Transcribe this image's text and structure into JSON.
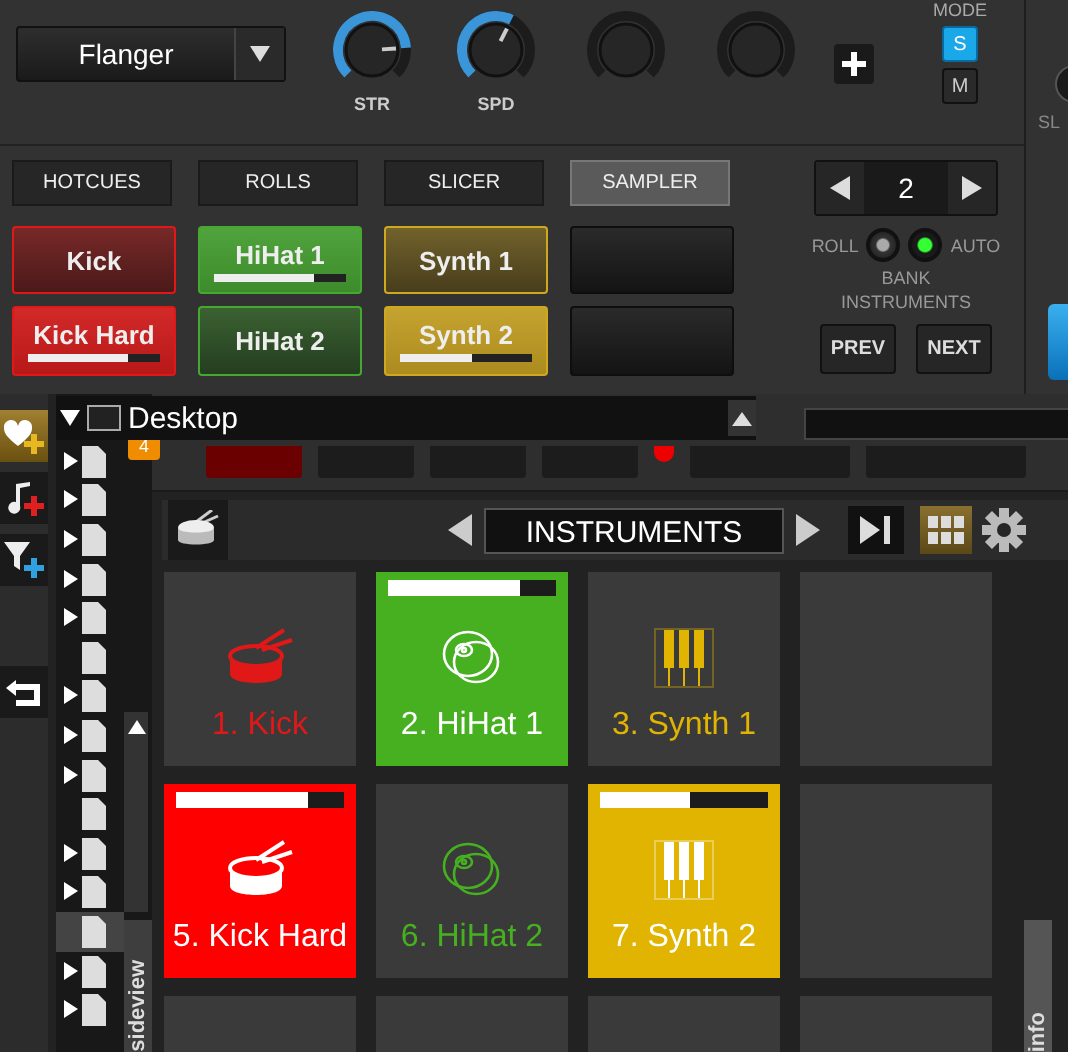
{
  "effect": {
    "value": "Flanger"
  },
  "knobs": [
    {
      "kind": "effect",
      "label": "STR",
      "level": 0.82
    },
    {
      "kind": "effect",
      "label": "SPD",
      "level": 0.6
    },
    {
      "kind": "blank"
    },
    {
      "kind": "blank"
    }
  ],
  "mode": {
    "label": "MODE",
    "options": [
      {
        "label": "S",
        "selected": true
      },
      {
        "label": "M",
        "selected": false
      }
    ]
  },
  "side_label": "SL",
  "tabs": [
    {
      "label": "HOTCUES",
      "selected": false
    },
    {
      "label": "ROLLS",
      "selected": false
    },
    {
      "label": "SLICER",
      "selected": false
    },
    {
      "label": "SAMPLER",
      "selected": true
    }
  ],
  "pads": [
    {
      "kind": "sample",
      "label": "Kick",
      "color": "#e01818",
      "playing": false
    },
    {
      "kind": "sample",
      "label": "HiHat 1",
      "color": "#46a830",
      "playing": true,
      "level": 0.76
    },
    {
      "kind": "sample",
      "label": "Synth 1",
      "color": "#d0a820",
      "playing": false
    },
    {
      "kind": "empty"
    },
    {
      "kind": "sample",
      "label": "Kick Hard",
      "color": "#e01818",
      "playing": true,
      "level": 0.76
    },
    {
      "kind": "sample",
      "label": "HiHat 2",
      "color": "#46a830",
      "playing": false
    },
    {
      "kind": "sample",
      "label": "Synth 2",
      "color": "#d0a820",
      "playing": true,
      "level": 0.54
    },
    {
      "kind": "empty"
    }
  ],
  "bank": {
    "value": "2",
    "roll": {
      "label": "ROLL",
      "on": false
    },
    "auto": {
      "label": "AUTO",
      "on": true
    },
    "caption": "BANK INSTRUMENTS",
    "prev": "PREV",
    "next": "NEXT"
  },
  "deck_badge": "4",
  "tree": {
    "label": "Desktop",
    "expanded": true,
    "children": [
      {
        "has_children": true,
        "selected": false
      },
      {
        "has_children": true,
        "selected": false
      },
      {
        "has_children": true,
        "selected": false
      },
      {
        "has_children": true,
        "selected": false
      },
      {
        "has_children": true,
        "selected": false
      },
      {
        "has_children": false,
        "selected": false
      },
      {
        "has_children": true,
        "selected": false
      },
      {
        "has_children": true,
        "selected": false
      },
      {
        "has_children": true,
        "selected": false
      },
      {
        "has_children": false,
        "selected": false
      },
      {
        "has_children": true,
        "selected": false
      },
      {
        "has_children": true,
        "selected": false
      },
      {
        "has_children": false,
        "selected": true
      },
      {
        "has_children": true,
        "selected": false
      },
      {
        "has_children": true,
        "selected": false
      }
    ]
  },
  "sampler": {
    "title": "INSTRUMENTS",
    "cells": [
      {
        "kind": "sample",
        "label": "1. Kick",
        "color": "#e01818",
        "playing": false
      },
      {
        "kind": "sample",
        "label": "2. HiHat 1",
        "color": "#46b020",
        "playing": true,
        "level": 0.78
      },
      {
        "kind": "sample",
        "label": "3. Synth 1",
        "color": "#e0b400",
        "playing": false
      },
      {
        "kind": "empty"
      },
      {
        "kind": "sample",
        "label": "5. Kick Hard",
        "color": "#ff0000",
        "playing": true,
        "level": 0.78
      },
      {
        "kind": "sample",
        "label": "6. HiHat 2",
        "color": "#46b020",
        "playing": false
      },
      {
        "kind": "sample",
        "label": "7. Synth 2",
        "color": "#e0b400",
        "playing": true,
        "level": 0.54
      },
      {
        "kind": "empty"
      },
      {
        "kind": "empty"
      },
      {
        "kind": "empty"
      },
      {
        "kind": "empty"
      },
      {
        "kind": "empty"
      }
    ]
  },
  "side_tabs": {
    "left": "sideview",
    "right": "info"
  }
}
